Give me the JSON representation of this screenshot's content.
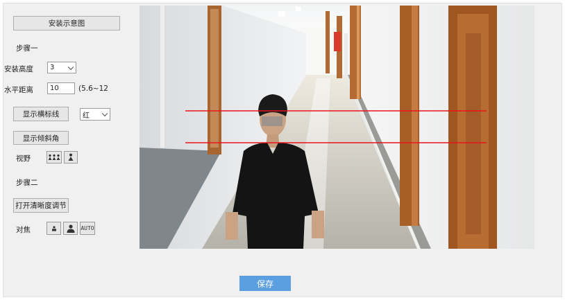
{
  "left_panel": {
    "diagram_button": "安装示意图",
    "step1_label": "步骤一",
    "height_label": "安装高度",
    "height_value": "3",
    "distance_label": "水平距离",
    "distance_value": "10",
    "distance_range": "(5.6~12.6",
    "show_ruler_button": "显示横标线",
    "ruler_color_value": "红",
    "show_tilt_button": "显示倾斜角",
    "view_label": "视野",
    "step2_label": "步骤二",
    "clarity_button": "打开清晰度调节",
    "focus_label": "对焦",
    "focus_auto_label": "AUTO"
  },
  "footer": {
    "save_label": "保存"
  },
  "colors": {
    "guide_line": "#e8141c",
    "save_button": "#5b9fe0"
  }
}
